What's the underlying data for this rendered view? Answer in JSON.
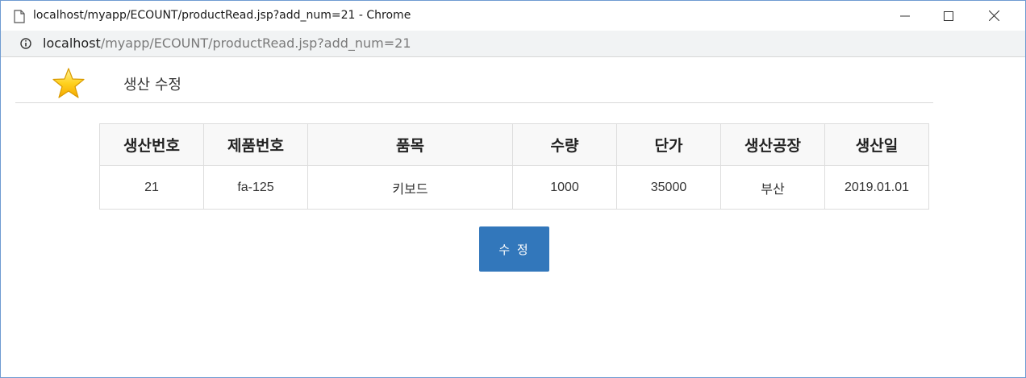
{
  "window": {
    "title": "localhost/myapp/ECOUNT/productRead.jsp?add_num=21 - Chrome"
  },
  "address_bar": {
    "host": "localhost",
    "path": "/myapp/ECOUNT/productRead.jsp?add_num=21"
  },
  "page": {
    "title": "생산 수정"
  },
  "table": {
    "headers": [
      "생산번호",
      "제품번호",
      "품목",
      "수량",
      "단가",
      "생산공장",
      "생산일"
    ],
    "rows": [
      [
        "21",
        "fa-125",
        "키보드",
        "1000",
        "35000",
        "부산",
        "2019.01.01"
      ]
    ]
  },
  "actions": {
    "edit_label": "수 정"
  },
  "colors": {
    "button_bg": "#3277bb",
    "window_border": "#6f9bd1",
    "star_fill": "#ffd21f"
  },
  "icons": [
    "page-icon",
    "minimize-icon",
    "maximize-icon",
    "close-icon",
    "info-icon",
    "star-icon"
  ]
}
